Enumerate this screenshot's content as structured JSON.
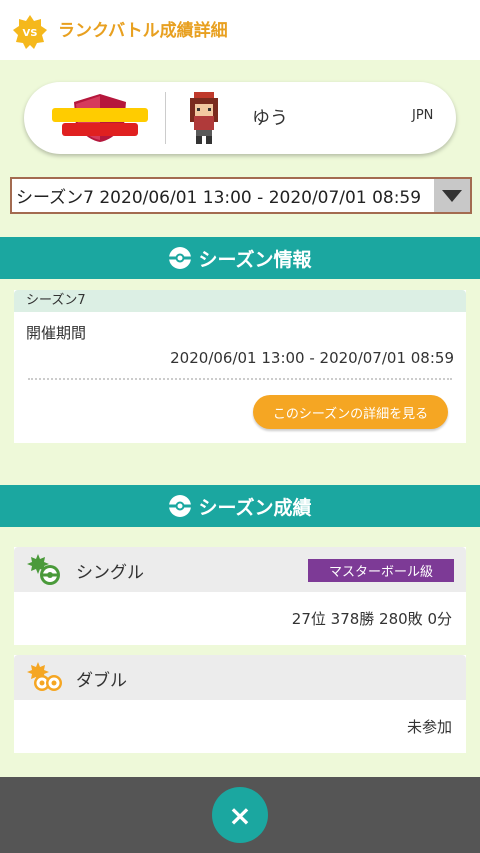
{
  "header": {
    "title": "ランクバトル成績詳細",
    "badge_text": "VS"
  },
  "trainer": {
    "game_logo_text": "ポケットモンスター シールド",
    "name": "ゆう",
    "region": "JPN"
  },
  "season_select": {
    "value": "シーズン7 2020/06/01 13:00 - 2020/07/01 08:59"
  },
  "season_info": {
    "section_title": "シーズン情報",
    "card_title": "シーズン7",
    "period_label": "開催期間",
    "period_value": "2020/06/01 13:00 - 2020/07/01 08:59",
    "detail_button": "このシーズンの詳細を見る"
  },
  "results": {
    "section_title": "シーズン成績",
    "single": {
      "title": "シングル",
      "rank": "マスターボール級",
      "record": "27位 378勝 280敗 0分"
    },
    "double": {
      "title": "ダブル",
      "record": "未参加"
    }
  },
  "footer": {
    "close_symbol": "×"
  },
  "colors": {
    "teal": "#1ba7a0",
    "orange": "#f5a623",
    "purple": "#7d3a96",
    "background": "#eef9d9"
  }
}
